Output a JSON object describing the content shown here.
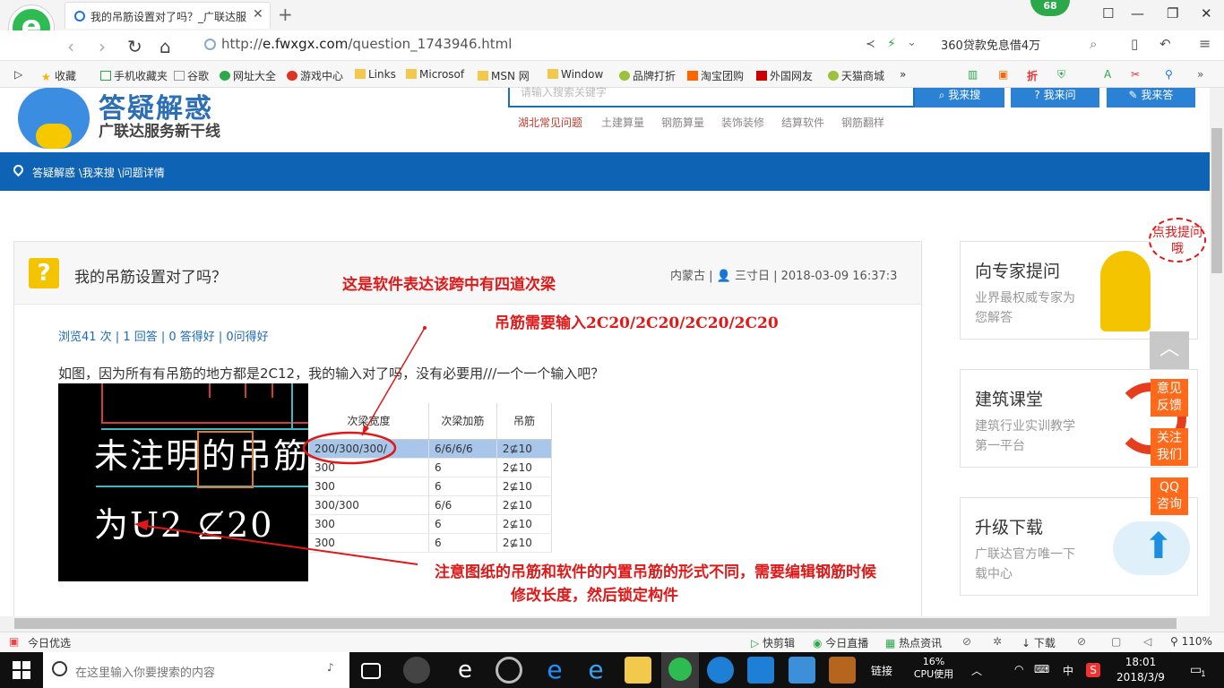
{
  "browser": {
    "tab_title": "我的吊筋设置对了吗？_广联达服",
    "url_host": "e.fwxgx.com",
    "url_prefix": "http://",
    "url_path": "/question_1743946.html",
    "badge_count": "68",
    "search_hint": "360贷款免息借4万",
    "bookmarks": [
      "收藏",
      "手机收藏夹",
      "谷歌",
      "网址大全",
      "游戏中心",
      "Links",
      "Microsof",
      "MSN 网",
      "Window",
      "品牌打折",
      "淘宝团购",
      "外国网友",
      "天猫商城",
      "»"
    ]
  },
  "site": {
    "title": "答疑解惑",
    "subtitle": "广联达服务新干线",
    "search_placeholder": "请输入搜索关键字",
    "buttons": [
      "我来搜",
      "我来问",
      "我来答"
    ],
    "nav": [
      "湖北常见问题",
      "土建算量",
      "钢筋算量",
      "装饰装修",
      "结算软件",
      "钢筋翻样"
    ],
    "breadcrumb": "答疑解惑 \\我来搜 \\问题详情"
  },
  "question": {
    "icon": "?",
    "title": "我的吊筋设置对了吗？",
    "meta": "内蒙古 | 👤 三寸日 | 2018-03-09 16:37:3",
    "stats": "浏览41 次 | 1 回答 | 0 答得好 | 0问得好",
    "body": "如图，因为所有有吊筋的地方都是2C12，我的输入对了吗，没有必要用///一个一个输入吧？",
    "cad_line1": "未注明的吊筋",
    "cad_line2": "为U2 ⊈20"
  },
  "table": {
    "headers": [
      "次梁宽度",
      "次梁加筋",
      "吊筋"
    ],
    "rows": [
      [
        "200/300/300/",
        "6/6/6/6",
        "2⊈10"
      ],
      [
        "300",
        "6",
        "2⊈10"
      ],
      [
        "300",
        "6",
        "2⊈10"
      ],
      [
        "300/300",
        "6/6",
        "2⊈10"
      ],
      [
        "300",
        "6",
        "2⊈10"
      ],
      [
        "300",
        "6",
        "2⊈10"
      ]
    ]
  },
  "annotations": {
    "a1": "这是软件表达该跨中有四道次梁",
    "a2": "吊筋需要输入2C20/2C20/2C20/2C20",
    "a3_line1": "注意图纸的吊筋和软件的内置吊筋的形式不同，需要编辑钢筋时候",
    "a3_line2": "修改长度，然后锁定构件"
  },
  "sidebar": {
    "cards": [
      {
        "title": "向专家提问",
        "desc": "业界最权威专家为您解答"
      },
      {
        "title": "建筑课堂",
        "desc": "建筑行业实训教学第一平台"
      },
      {
        "title": "升级下载",
        "desc": "广联达官方唯一下载中心"
      }
    ],
    "bubble": "点我提问哦",
    "float_buttons": [
      "意见反馈",
      "关注我们",
      "QQ咨询"
    ]
  },
  "statusbar": {
    "left": "今日优选",
    "items": [
      "快剪辑",
      "今日直播",
      "热点资讯",
      "下载",
      "110%"
    ]
  },
  "taskbar": {
    "search_placeholder": "在这里输入你要搜索的内容",
    "link": "链接",
    "cpu_percent": "16%",
    "cpu_label": "CPU使用",
    "ime": "中",
    "time": "18:01",
    "date": "2018/3/9",
    "notif": "1"
  },
  "colors": {
    "accent": "#0e63b5",
    "annotation": "#e01818",
    "orange": "#ff6a1a"
  }
}
